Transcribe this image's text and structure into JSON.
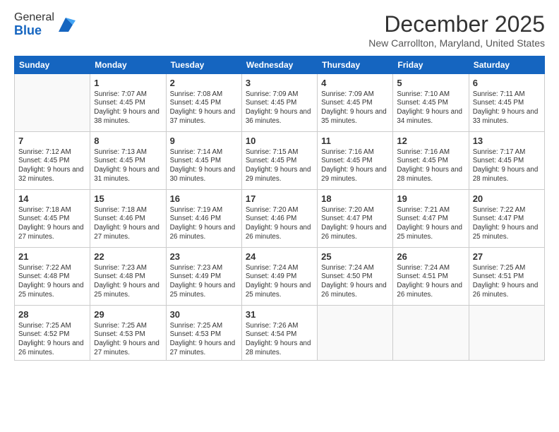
{
  "logo": {
    "general": "General",
    "blue": "Blue"
  },
  "header": {
    "month": "December 2025",
    "location": "New Carrollton, Maryland, United States"
  },
  "weekdays": [
    "Sunday",
    "Monday",
    "Tuesday",
    "Wednesday",
    "Thursday",
    "Friday",
    "Saturday"
  ],
  "weeks": [
    [
      {
        "day": "",
        "sunrise": "",
        "sunset": "",
        "daylight": ""
      },
      {
        "day": "1",
        "sunrise": "Sunrise: 7:07 AM",
        "sunset": "Sunset: 4:45 PM",
        "daylight": "Daylight: 9 hours and 38 minutes."
      },
      {
        "day": "2",
        "sunrise": "Sunrise: 7:08 AM",
        "sunset": "Sunset: 4:45 PM",
        "daylight": "Daylight: 9 hours and 37 minutes."
      },
      {
        "day": "3",
        "sunrise": "Sunrise: 7:09 AM",
        "sunset": "Sunset: 4:45 PM",
        "daylight": "Daylight: 9 hours and 36 minutes."
      },
      {
        "day": "4",
        "sunrise": "Sunrise: 7:09 AM",
        "sunset": "Sunset: 4:45 PM",
        "daylight": "Daylight: 9 hours and 35 minutes."
      },
      {
        "day": "5",
        "sunrise": "Sunrise: 7:10 AM",
        "sunset": "Sunset: 4:45 PM",
        "daylight": "Daylight: 9 hours and 34 minutes."
      },
      {
        "day": "6",
        "sunrise": "Sunrise: 7:11 AM",
        "sunset": "Sunset: 4:45 PM",
        "daylight": "Daylight: 9 hours and 33 minutes."
      }
    ],
    [
      {
        "day": "7",
        "sunrise": "Sunrise: 7:12 AM",
        "sunset": "Sunset: 4:45 PM",
        "daylight": "Daylight: 9 hours and 32 minutes."
      },
      {
        "day": "8",
        "sunrise": "Sunrise: 7:13 AM",
        "sunset": "Sunset: 4:45 PM",
        "daylight": "Daylight: 9 hours and 31 minutes."
      },
      {
        "day": "9",
        "sunrise": "Sunrise: 7:14 AM",
        "sunset": "Sunset: 4:45 PM",
        "daylight": "Daylight: 9 hours and 30 minutes."
      },
      {
        "day": "10",
        "sunrise": "Sunrise: 7:15 AM",
        "sunset": "Sunset: 4:45 PM",
        "daylight": "Daylight: 9 hours and 29 minutes."
      },
      {
        "day": "11",
        "sunrise": "Sunrise: 7:16 AM",
        "sunset": "Sunset: 4:45 PM",
        "daylight": "Daylight: 9 hours and 29 minutes."
      },
      {
        "day": "12",
        "sunrise": "Sunrise: 7:16 AM",
        "sunset": "Sunset: 4:45 PM",
        "daylight": "Daylight: 9 hours and 28 minutes."
      },
      {
        "day": "13",
        "sunrise": "Sunrise: 7:17 AM",
        "sunset": "Sunset: 4:45 PM",
        "daylight": "Daylight: 9 hours and 28 minutes."
      }
    ],
    [
      {
        "day": "14",
        "sunrise": "Sunrise: 7:18 AM",
        "sunset": "Sunset: 4:45 PM",
        "daylight": "Daylight: 9 hours and 27 minutes."
      },
      {
        "day": "15",
        "sunrise": "Sunrise: 7:18 AM",
        "sunset": "Sunset: 4:46 PM",
        "daylight": "Daylight: 9 hours and 27 minutes."
      },
      {
        "day": "16",
        "sunrise": "Sunrise: 7:19 AM",
        "sunset": "Sunset: 4:46 PM",
        "daylight": "Daylight: 9 hours and 26 minutes."
      },
      {
        "day": "17",
        "sunrise": "Sunrise: 7:20 AM",
        "sunset": "Sunset: 4:46 PM",
        "daylight": "Daylight: 9 hours and 26 minutes."
      },
      {
        "day": "18",
        "sunrise": "Sunrise: 7:20 AM",
        "sunset": "Sunset: 4:47 PM",
        "daylight": "Daylight: 9 hours and 26 minutes."
      },
      {
        "day": "19",
        "sunrise": "Sunrise: 7:21 AM",
        "sunset": "Sunset: 4:47 PM",
        "daylight": "Daylight: 9 hours and 25 minutes."
      },
      {
        "day": "20",
        "sunrise": "Sunrise: 7:22 AM",
        "sunset": "Sunset: 4:47 PM",
        "daylight": "Daylight: 9 hours and 25 minutes."
      }
    ],
    [
      {
        "day": "21",
        "sunrise": "Sunrise: 7:22 AM",
        "sunset": "Sunset: 4:48 PM",
        "daylight": "Daylight: 9 hours and 25 minutes."
      },
      {
        "day": "22",
        "sunrise": "Sunrise: 7:23 AM",
        "sunset": "Sunset: 4:48 PM",
        "daylight": "Daylight: 9 hours and 25 minutes."
      },
      {
        "day": "23",
        "sunrise": "Sunrise: 7:23 AM",
        "sunset": "Sunset: 4:49 PM",
        "daylight": "Daylight: 9 hours and 25 minutes."
      },
      {
        "day": "24",
        "sunrise": "Sunrise: 7:24 AM",
        "sunset": "Sunset: 4:49 PM",
        "daylight": "Daylight: 9 hours and 25 minutes."
      },
      {
        "day": "25",
        "sunrise": "Sunrise: 7:24 AM",
        "sunset": "Sunset: 4:50 PM",
        "daylight": "Daylight: 9 hours and 26 minutes."
      },
      {
        "day": "26",
        "sunrise": "Sunrise: 7:24 AM",
        "sunset": "Sunset: 4:51 PM",
        "daylight": "Daylight: 9 hours and 26 minutes."
      },
      {
        "day": "27",
        "sunrise": "Sunrise: 7:25 AM",
        "sunset": "Sunset: 4:51 PM",
        "daylight": "Daylight: 9 hours and 26 minutes."
      }
    ],
    [
      {
        "day": "28",
        "sunrise": "Sunrise: 7:25 AM",
        "sunset": "Sunset: 4:52 PM",
        "daylight": "Daylight: 9 hours and 26 minutes."
      },
      {
        "day": "29",
        "sunrise": "Sunrise: 7:25 AM",
        "sunset": "Sunset: 4:53 PM",
        "daylight": "Daylight: 9 hours and 27 minutes."
      },
      {
        "day": "30",
        "sunrise": "Sunrise: 7:25 AM",
        "sunset": "Sunset: 4:53 PM",
        "daylight": "Daylight: 9 hours and 27 minutes."
      },
      {
        "day": "31",
        "sunrise": "Sunrise: 7:26 AM",
        "sunset": "Sunset: 4:54 PM",
        "daylight": "Daylight: 9 hours and 28 minutes."
      },
      {
        "day": "",
        "sunrise": "",
        "sunset": "",
        "daylight": ""
      },
      {
        "day": "",
        "sunrise": "",
        "sunset": "",
        "daylight": ""
      },
      {
        "day": "",
        "sunrise": "",
        "sunset": "",
        "daylight": ""
      }
    ]
  ]
}
